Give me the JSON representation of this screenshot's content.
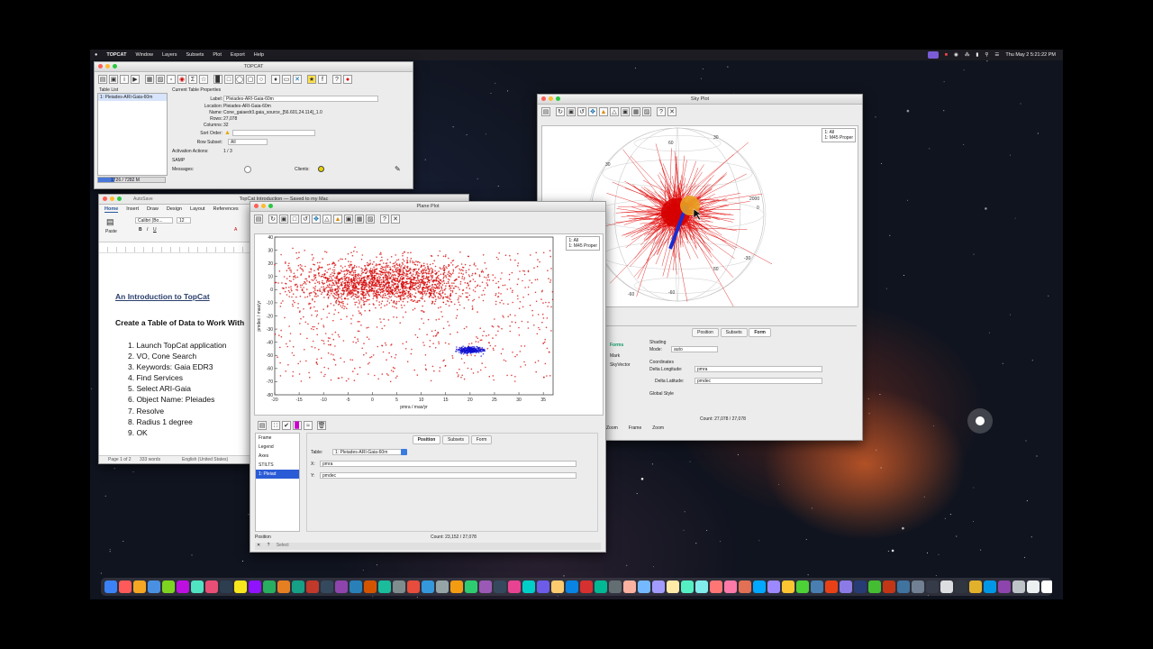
{
  "menubar": {
    "app": "TOPCAT",
    "items": [
      "Window",
      "Layers",
      "Subsets",
      "Plot",
      "Export",
      "Help"
    ],
    "clock": "Thu May 2  5:21:22 PM"
  },
  "topcat": {
    "title": "TOPCAT",
    "table_list_label": "Table List",
    "table_item": "1: Pleiades-ARI-Gaia-60m",
    "props_label": "Current Table Properties",
    "label_k": "Label:",
    "label_v": "Pleiades-ARI-Gaia-60m",
    "location_k": "Location:",
    "location_v": "Pleiades-ARI-Gaia-60m",
    "name_k": "Name:",
    "name_v": "Cone_gaiaedr3.gaia_source_[56.601,24.114]_1.0",
    "rows_k": "Rows:",
    "rows_v": "27,078",
    "columns_k": "Columns:",
    "columns_v": "32",
    "sort_k": "Sort Order:",
    "subset_k": "Row Subset:",
    "subset_v": "All",
    "activation_k": "Activation Actions:",
    "activation_v": "1 / 3",
    "samp_label": "SAMP",
    "messages_k": "Messages:",
    "clients_k": "Clients:",
    "memory": "1726 / 7282 M"
  },
  "word": {
    "title": "TopCat Introduction — Saved to my Mac",
    "autosave": "AutoSave",
    "ribbon_tabs": [
      "Home",
      "Insert",
      "Draw",
      "Design",
      "Layout",
      "References"
    ],
    "font_name": "Calibri (Bo...",
    "font_size": "12",
    "paste": "Paste",
    "heading": "An Introduction to TopCat",
    "subheading": "Create a Table of Data to Work With",
    "steps": [
      "1.   Launch TopCat application",
      "2.   VO, Cone Search",
      "3.   Keywords: Gaia EDR3",
      "4.   Find Services",
      "5.   Select ARI-Gaia",
      "6.   Object Name: Pleiades",
      "7.   Resolve",
      "8.   Radius 1 degree",
      "9.   OK"
    ],
    "status_page": "Page 1 of 2",
    "status_words": "333 words",
    "status_lang": "English (United States)"
  },
  "sky": {
    "title": "Sky Plot",
    "legend": [
      "1: All",
      "1: M45 Proper"
    ],
    "grid_labels": [
      "60",
      "30",
      "0",
      "-30",
      "-60",
      "2000",
      "60",
      "-60",
      "30",
      "0"
    ],
    "tabs": [
      "Position",
      "Subsets",
      "Form"
    ],
    "layers": [
      "Forms",
      "Mark",
      "SkyVector"
    ],
    "shading_label": "Shading",
    "mode_k": "Mode:",
    "mode_v": "auto",
    "coords_label": "Coordinates",
    "dlon_k": "Delta Longitude:",
    "dlon_v": "pmra",
    "dlat_k": "Delta Latitude:",
    "dlat_v": "pmdec",
    "global_label": "Global Style",
    "status_count": "Count: 27,078 / 27,078",
    "zoom_labels": [
      "Zoom",
      "Frame",
      "Zoom"
    ]
  },
  "plane": {
    "title": "Plane Plot",
    "legend": [
      "1: All",
      "1: M45 Proper"
    ],
    "layers": [
      "Frame",
      "Legend",
      "Axes",
      "STILTS",
      "1: Pleiad"
    ],
    "tabs": [
      "Position",
      "Subsets",
      "Form"
    ],
    "table_k": "Table:",
    "table_v": "1: Pleiades-ARI-Gaia-60m",
    "x_k": "X:",
    "x_v": "pmra",
    "y_k": "Y:",
    "y_v": "pmdec",
    "status_left": "Position",
    "status_count": "Count: 23,152 / 27,078",
    "select_label": "Select"
  },
  "chart_data": {
    "type": "scatter",
    "xlabel": "pmra / mas/yr",
    "ylabel": "pmdec / mas/yr",
    "xlim": [
      -20,
      37
    ],
    "ylim": [
      -80,
      40
    ],
    "x_ticks": [
      -20,
      -15,
      -10,
      -5,
      0,
      5,
      10,
      15,
      20,
      25,
      30,
      35
    ],
    "y_ticks": [
      40,
      30,
      20,
      10,
      0,
      -10,
      -20,
      -30,
      -40,
      -50,
      -60,
      -70,
      -80
    ],
    "series": [
      {
        "name": "1: All",
        "color": "#d40000",
        "center": [
          2,
          5
        ],
        "spread": [
          9,
          8
        ],
        "n": 2600
      },
      {
        "name": "1: M45 Proper",
        "color": "#1010d0",
        "center": [
          20,
          -46
        ],
        "spread": [
          1.3,
          1.2
        ],
        "n": 320
      }
    ]
  }
}
